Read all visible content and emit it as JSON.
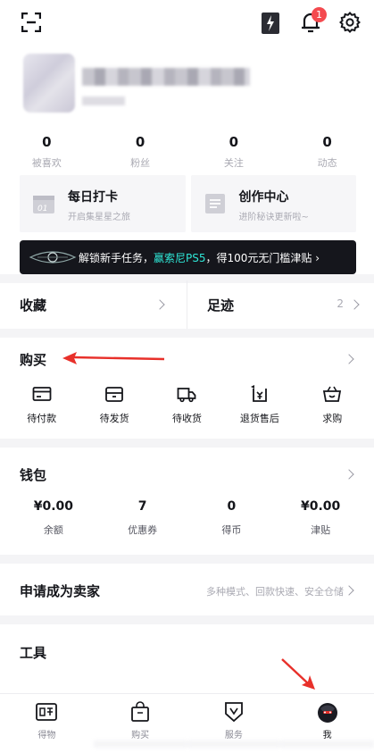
{
  "notifications": {
    "badge": "1"
  },
  "stats": [
    {
      "value": "0",
      "label": "被喜欢"
    },
    {
      "value": "0",
      "label": "粉丝"
    },
    {
      "value": "0",
      "label": "关注"
    },
    {
      "value": "0",
      "label": "动态"
    }
  ],
  "cards": [
    {
      "title": "每日打卡",
      "subtitle": "开启集星星之旅",
      "icon_text": "01"
    },
    {
      "title": "创作中心",
      "subtitle": "进阶秘诀更新啦~"
    }
  ],
  "banner": {
    "prefix": "解锁新手任务，",
    "highlight": "赢索尼PS5",
    "suffix": "，得100元无门槛津贴 ›"
  },
  "shortcuts": {
    "favorites": "收藏",
    "history": "足迹",
    "history_count": "2"
  },
  "purchase": {
    "title": "购买",
    "items": [
      {
        "label": "待付款",
        "icon": "card-icon"
      },
      {
        "label": "待发货",
        "icon": "box-icon"
      },
      {
        "label": "待收货",
        "icon": "truck-icon"
      },
      {
        "label": "退货售后",
        "icon": "return-icon"
      },
      {
        "label": "求购",
        "icon": "basket-icon"
      }
    ]
  },
  "wallet": {
    "title": "钱包",
    "items": [
      {
        "value": "¥0.00",
        "label": "余额"
      },
      {
        "value": "7",
        "label": "优惠券"
      },
      {
        "value": "0",
        "label": "得币"
      },
      {
        "value": "¥0.00",
        "label": "津贴"
      }
    ]
  },
  "seller": {
    "title": "申请成为卖家",
    "desc": "多种模式、回款快速、安全仓储"
  },
  "tools": {
    "title": "工具"
  },
  "tabbar": [
    {
      "label": "得物",
      "icon": "dewu-logo-icon"
    },
    {
      "label": "购买",
      "icon": "shopping-bag-icon"
    },
    {
      "label": "服务",
      "icon": "shield-icon"
    },
    {
      "label": "我",
      "icon": "profile-avatar-icon",
      "active": true
    }
  ],
  "colors": {
    "accent_teal": "#2ee6d6",
    "badge_red": "#f44a4f",
    "annotation_red": "#e8302a"
  }
}
